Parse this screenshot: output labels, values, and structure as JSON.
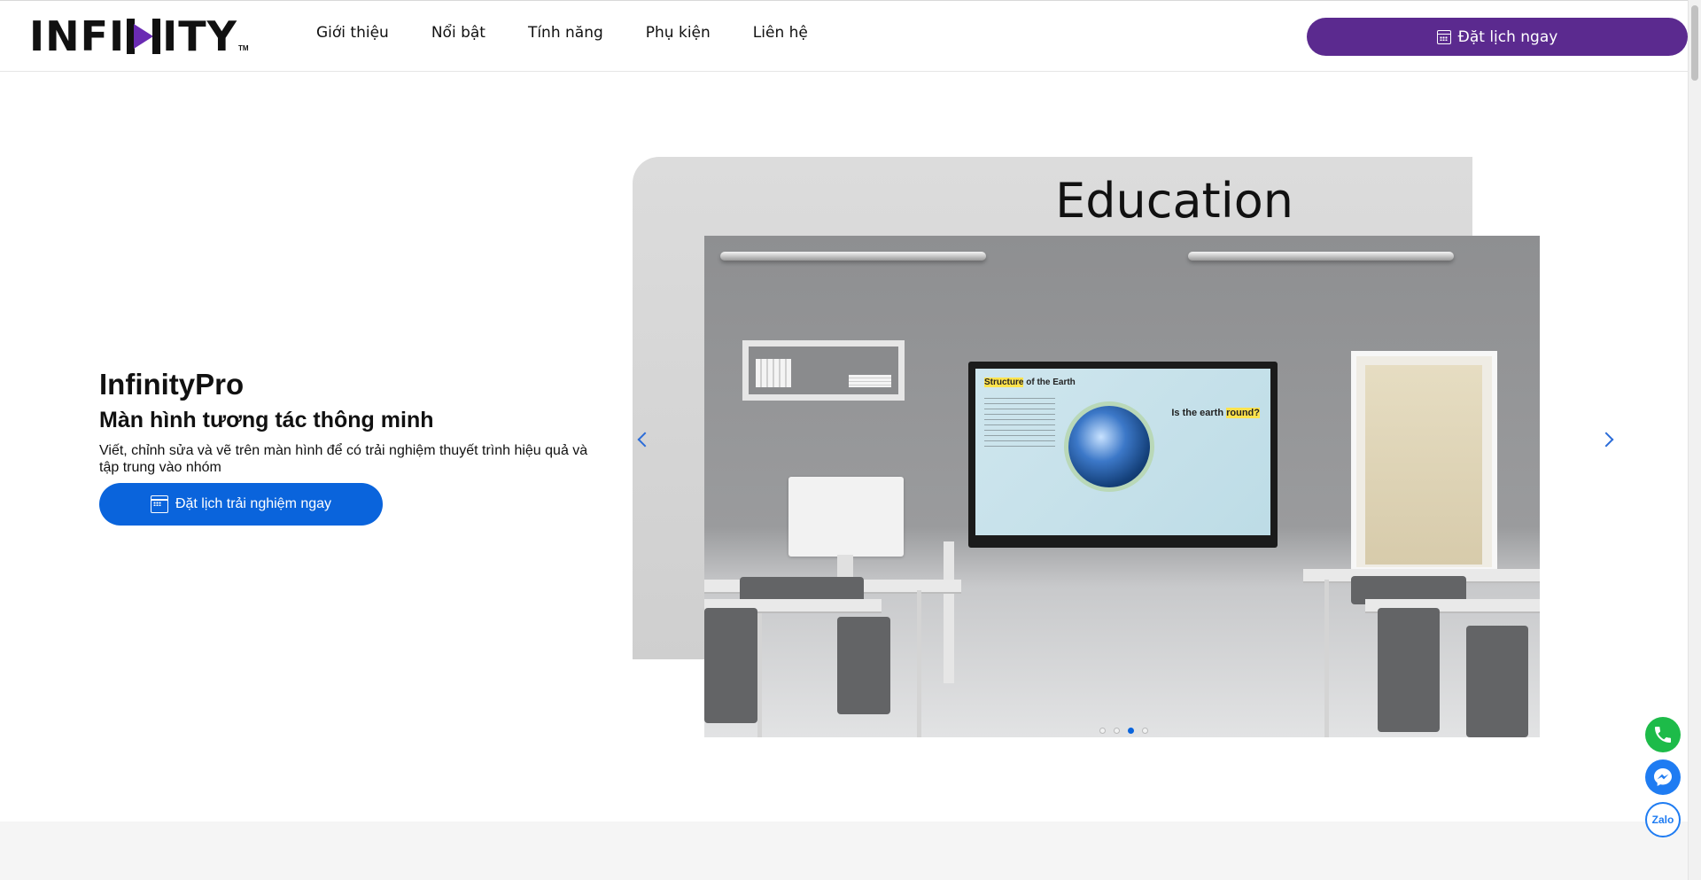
{
  "header": {
    "logo_text": "INFINITY",
    "logo_tm": "TM",
    "nav": [
      "Giới thiệu",
      "Nổi bật",
      "Tính năng",
      "Phụ kiện",
      "Liên hệ"
    ],
    "cta_label": "Đặt lịch ngay",
    "cta_icon": "calendar-icon",
    "brand_color": "#5b2a8f"
  },
  "hero": {
    "title": "InfinityPro",
    "subtitle": "Màn hình tương tác thông minh",
    "description": "Viết, chỉnh sửa và vẽ trên màn hình để có trải nghiệm thuyết trình hiệu quả và tập trung vào nhóm",
    "cta_label": "Đặt lịch trải nghiệm ngay",
    "cta_icon": "calendar-icon",
    "cta_color": "#0a64dc"
  },
  "carousel": {
    "slide_label": "Education",
    "tv_heading_a": "Structure",
    "tv_heading_b": " of the Earth",
    "tv_side_a": "Is the earth ",
    "tv_side_b": "round?",
    "slide_count": 4,
    "active_slide": 3,
    "prev_icon": "chevron-left-icon",
    "next_icon": "chevron-right-icon"
  },
  "floating_contacts": [
    {
      "icon": "phone-icon",
      "color": "#1dbb49"
    },
    {
      "icon": "messenger-icon",
      "color": "#1f7cf2"
    },
    {
      "icon": "zalo-icon",
      "label": "Zalo",
      "color": "#1f7cf2"
    }
  ]
}
